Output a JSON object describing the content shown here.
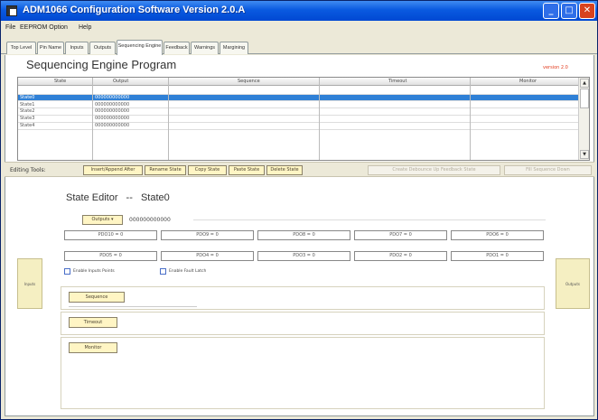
{
  "window": {
    "title": "ADM1066 Configuration Software    Version 2.0.A"
  },
  "menu": [
    "File",
    "EEPROM Option",
    "Help"
  ],
  "tabs": [
    "Top Level",
    "Pin Name",
    "Inputs",
    "Outputs",
    "Sequencing Engine",
    "Feedback",
    "Warnings",
    "Margining"
  ],
  "active_tab": "Sequencing Engine",
  "page": {
    "title": "Sequencing Engine Program",
    "version_label": "version 2.0"
  },
  "grid": {
    "columns": [
      "State",
      "Output",
      "Sequence",
      "Timeout",
      "Monitor"
    ],
    "rows": [
      {
        "state": "",
        "output": "",
        "selected": false
      },
      {
        "state": "State0",
        "output": "000000000000",
        "selected": true
      },
      {
        "state": "State1",
        "output": "000000000000",
        "selected": false
      },
      {
        "state": "State2",
        "output": "000000000000",
        "selected": false
      },
      {
        "state": "State3",
        "output": "000000000000",
        "selected": false
      },
      {
        "state": "State4",
        "output": "000000000000",
        "selected": false
      }
    ]
  },
  "tools": {
    "label": "Editing Tools:",
    "buttons": [
      {
        "label": "Insert/Append After",
        "enabled": true
      },
      {
        "label": "Rename State",
        "enabled": true
      },
      {
        "label": "Copy State",
        "enabled": true
      },
      {
        "label": "Paste State",
        "enabled": true
      },
      {
        "label": "Delete State",
        "enabled": true
      },
      {
        "label": "Create Debounce Up Feedback State",
        "enabled": false
      },
      {
        "label": "Fill Sequence Down",
        "enabled": false
      }
    ]
  },
  "side": {
    "left": "Inputs",
    "right": "Outputs"
  },
  "editor": {
    "title_prefix": "State Editor",
    "separator": "--",
    "state_name": "State0",
    "outputs_button": "Outputs",
    "outputs_value": "000000000000",
    "fields_row1": [
      "PDO10 = 0",
      "PDO9 = 0",
      "PDO8 = 0",
      "PDO7 = 0",
      "PDO6 = 0"
    ],
    "fields_row2": [
      "PDO5 = 0",
      "PDO4 = 0",
      "PDO3 = 0",
      "PDO2 = 0",
      "PDO1 = 0"
    ],
    "check_inputs": "Enable Inputs Points",
    "check_faults": "Enable Fault Latch",
    "section_buttons": [
      "Sequence",
      "Timeout",
      "Monitor"
    ]
  },
  "colors": {
    "title_bar": "#0a5ae0",
    "selection": "#2f80d6",
    "accent_red": "#e23a1c",
    "button_bg": "#fff5c4"
  }
}
